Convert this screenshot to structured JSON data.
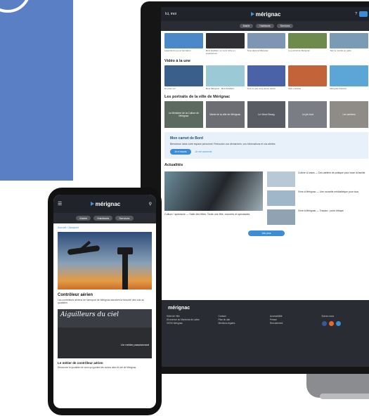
{
  "colors": {
    "accent_blue": "#5b7fc4",
    "brand_blue": "#3b8ed6",
    "dark_bar": "#21232a"
  },
  "monitor": {
    "topbar": {
      "left_text": "Ici, moi",
      "logo": "mérignac"
    },
    "pills": [
      "Mairie",
      "Habitants",
      "Services"
    ],
    "section1": {
      "captions": [
        "Légende du jeu et formation",
        "Mois Etudiant, un mois riche en expériences",
        "Tous dans la Mérignac",
        "Le journal de Mérignac",
        "Tout le monde en parle"
      ]
    },
    "section2": {
      "title": "Vidéo à la une",
      "captions": [
        "En plein vol",
        "Mois Mérignac : Mois Etudiant",
        "Tout ce que vous devez savoir",
        "Mon entraîné",
        "Mérignac Passion"
      ]
    },
    "section3": {
      "title": "Les portraits de la ville de Mérignac",
      "tiles": [
        "Le Ministère de la Culture de Mérignac",
        "Mairie de la ville de Mérignac",
        "Le Vieux Bourg",
        "Le pin tord",
        "Les sentiers"
      ]
    },
    "callout": {
      "title": "Mon carnet de Bord",
      "text": "Bienvenue dans votre espace personnel. Retrouvez vos démarches, vos informations et vos alertes.",
      "primary": "Je m'inscris",
      "secondary": "Je me connecte"
    },
    "news": {
      "title": "Actualités",
      "main_caption": "Culture / spectacle — Salle des fêtes. Toute une fête, concerts et spectacles.",
      "items": [
        "Culture & loisirs — Des ateliers de pratique pour toute la famille",
        "Vivre à Mérignac — Une nouvelle médiathèque pour tous",
        "Vivre à Mérignac — Travaux : point d'étape"
      ],
      "more": "Voir plus"
    },
    "footer": {
      "logo": "mérignac",
      "col1": [
        "Hôtel de Ville",
        "60 avenue du Maréchal de Lattre",
        "33700 Mérignac"
      ],
      "col2": [
        "Contact",
        "Plan du site",
        "Mentions légales"
      ],
      "col3": [
        "Accessibilité",
        "Presse",
        "Recrutement"
      ],
      "col4": [
        "Suivez-nous"
      ]
    }
  },
  "phone": {
    "topbar": {
      "logo": "mérignac"
    },
    "pills": [
      "Mairie",
      "Habitants",
      "Services"
    ],
    "breadcrumb": "Accueil / Aéroport",
    "article_title": "Contrôleur aérien",
    "article_text": "Les contrôleurs aériens de l'aéroport de Mérignac assurent la sécurité des vols au quotidien.",
    "image2_caption": "Aiguilleurs du ciel",
    "image2_sub": "Un métier passionnant",
    "subtitle": "Le métier de contrôleur aérien",
    "subtitle_text": "Découvrez le quotidien de ceux qui guident les avions dans le ciel de Mérignac."
  }
}
